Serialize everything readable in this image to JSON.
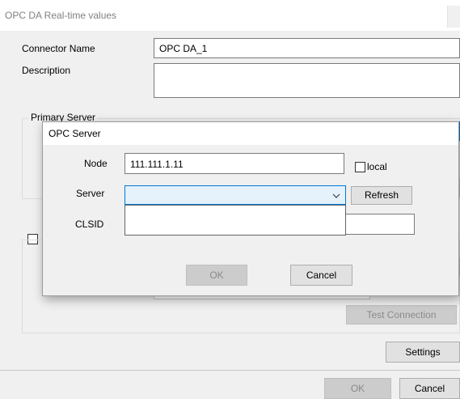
{
  "window": {
    "title": "OPC DA Real-time values"
  },
  "form": {
    "connector_name_label": "Connector Name",
    "connector_name_value": "OPC DA_1",
    "description_label": "Description",
    "description_value": "",
    "primary_server_label": "Primary Server",
    "test_connection_label": "Test Connection",
    "settings_label": "Settings",
    "ok_label": "OK",
    "cancel_label": "Cancel"
  },
  "dialog": {
    "title": "OPC Server",
    "node_label": "Node",
    "node_value": "111.111.1.11",
    "local_label": "local",
    "local_checked": false,
    "server_label": "Server",
    "server_value": "",
    "refresh_label": "Refresh",
    "clsid_label": "CLSID",
    "clsid_value": "",
    "ok_label": "OK",
    "cancel_label": "Cancel",
    "dropdown_options": []
  },
  "colors": {
    "focus_border": "#0078d7",
    "combo_focus_bg": "#e5f1fb",
    "disabled_text": "#8a8a8a"
  },
  "icons": {
    "combo_arrow": "chevron-down-icon"
  }
}
